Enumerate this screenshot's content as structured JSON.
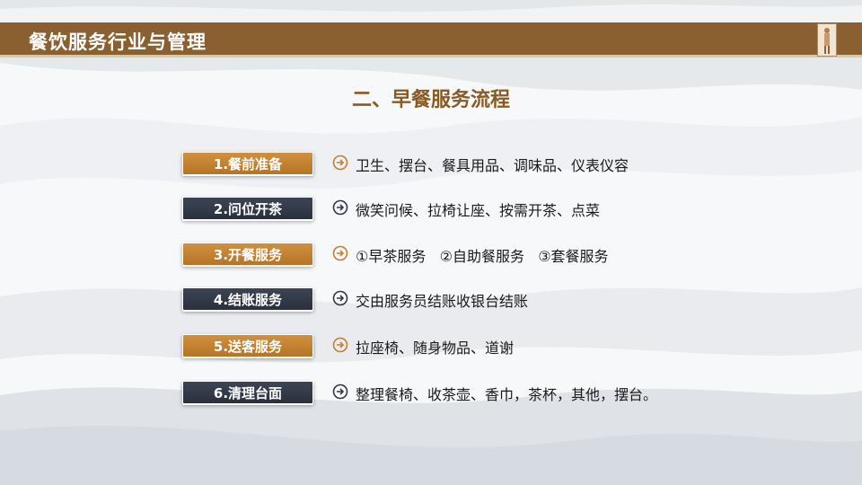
{
  "header": {
    "title": "餐饮服务行业与管理"
  },
  "section": {
    "title": "二、早餐服务流程"
  },
  "colors": {
    "header_bg": "#8a6030",
    "title": "#8a5a24",
    "accent_brown": "#c27f2f",
    "accent_dark": "#323846"
  },
  "steps": [
    {
      "label": "1.餐前准备",
      "desc": "卫生、摆台、餐具用品、调味品、仪表仪容",
      "style": "brown",
      "icon": "circle-arrow-right-icon"
    },
    {
      "label": "2.问位开茶",
      "desc": "微笑问候、拉椅让座、按需开茶、点菜",
      "style": "dark",
      "icon": "circle-arrow-right-icon"
    },
    {
      "label": "3.开餐服务",
      "desc": "①早茶服务   ②自助餐服务   ③套餐服务",
      "style": "brown",
      "icon": "circle-arrow-right-icon"
    },
    {
      "label": "4.结账服务",
      "desc": "交由服务员结账收银台结账",
      "style": "dark",
      "icon": "circle-arrow-right-icon"
    },
    {
      "label": "5.送客服务",
      "desc": "拉座椅、随身物品、道谢",
      "style": "brown",
      "icon": "circle-arrow-right-icon"
    },
    {
      "label": "6.清理台面",
      "desc": "整理餐椅、收茶壶、香巾，茶杯，其他，摆台。",
      "style": "dark",
      "icon": "circle-arrow-right-icon"
    }
  ]
}
